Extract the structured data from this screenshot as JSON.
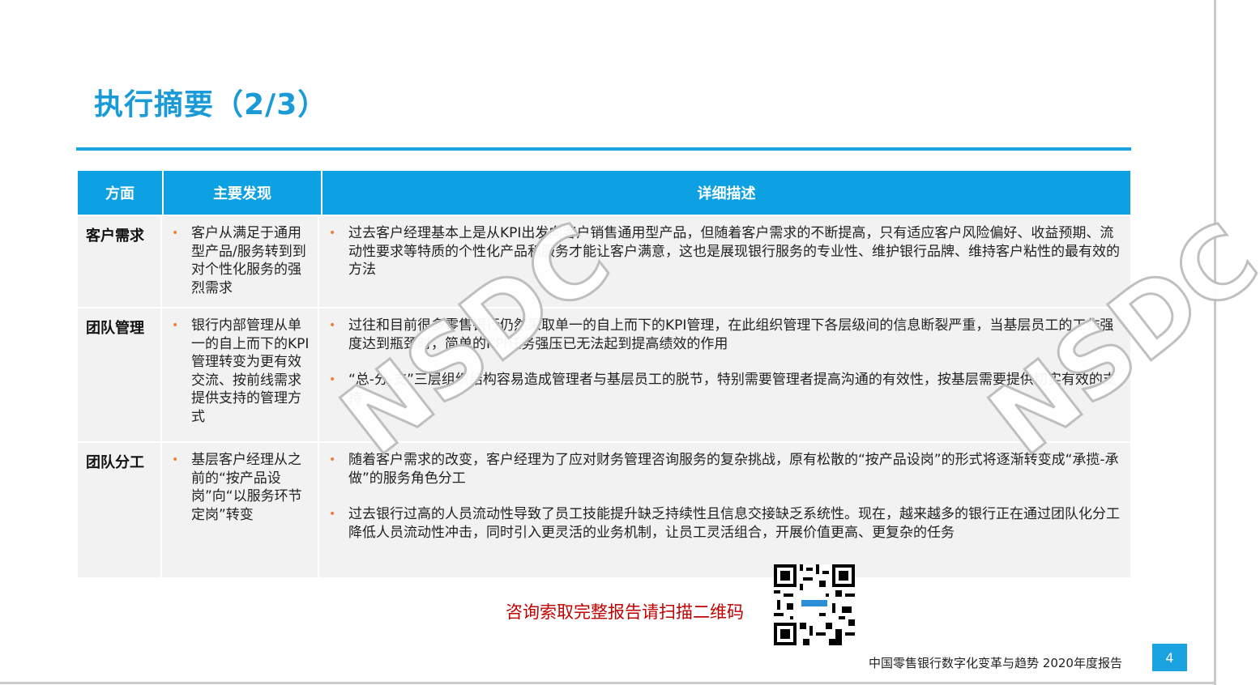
{
  "title": "执行摘要（2/3）",
  "table": {
    "headers": [
      "方面",
      "主要发现",
      "详细描述"
    ],
    "rows": [
      {
        "aspect": "客户需求",
        "finding": "客户从满足于通用型产品/服务转到到对个性化服务的强烈需求",
        "details": [
          "过去客户经理基本上是从KPI出发向客户销售通用型产品，但随着客户需求的不断提高，只有适应客户风险偏好、收益预期、流动性要求等特质的个性化产品和服务才能让客户满意，这也是展现银行服务的专业性、维护银行品牌、维持客户粘性的最有效的方法"
        ]
      },
      {
        "aspect": "团队管理",
        "finding": "银行内部管理从单一的自上而下的KPI管理转变为更有效交流、按前线需求提供支持的管理方式",
        "details": [
          "过往和目前很多零售银行仍然采取单一的自上而下的KPI管理，在此组织管理下各层级间的信息断裂严重，当基层员工的工作强度达到瓶颈时，简单的KPI任务强压已无法起到提高绩效的作用",
          "“总-分-支”三层组织结构容易造成管理者与基层员工的脱节，特别需要管理者提高沟通的有效性，按基层需要提供切实有效的支持"
        ]
      },
      {
        "aspect": "团队分工",
        "finding": "基层客户经理从之前的“按产品设岗”向“以服务环节定岗”转变",
        "details": [
          "随着客户需求的改变，客户经理为了应对财务管理咨询服务的复杂挑战，原有松散的“按产品设岗”的形式将逐渐转变成“承揽-承做”的服务角色分工",
          "过去银行过高的人员流动性导致了员工技能提升缺乏持续性且信息交接缺乏系统性。现在，越来越多的银行正在通过团队化分工降低人员流动性冲击，同时引入更灵活的业务机制，让员工灵活组合，开展价值更高、更复杂的任务"
        ]
      }
    ]
  },
  "watermark": "NSDC",
  "cta": "咨询索取完整报告请扫描二维码",
  "footer": "中国零售银行数字化变革与趋势 2020年度报告",
  "page_number": "4",
  "colors": {
    "accent": "#1aa3e0",
    "header_bg": "#0da0e3",
    "bullet": "#ef7e3d",
    "cta": "#c00000"
  }
}
